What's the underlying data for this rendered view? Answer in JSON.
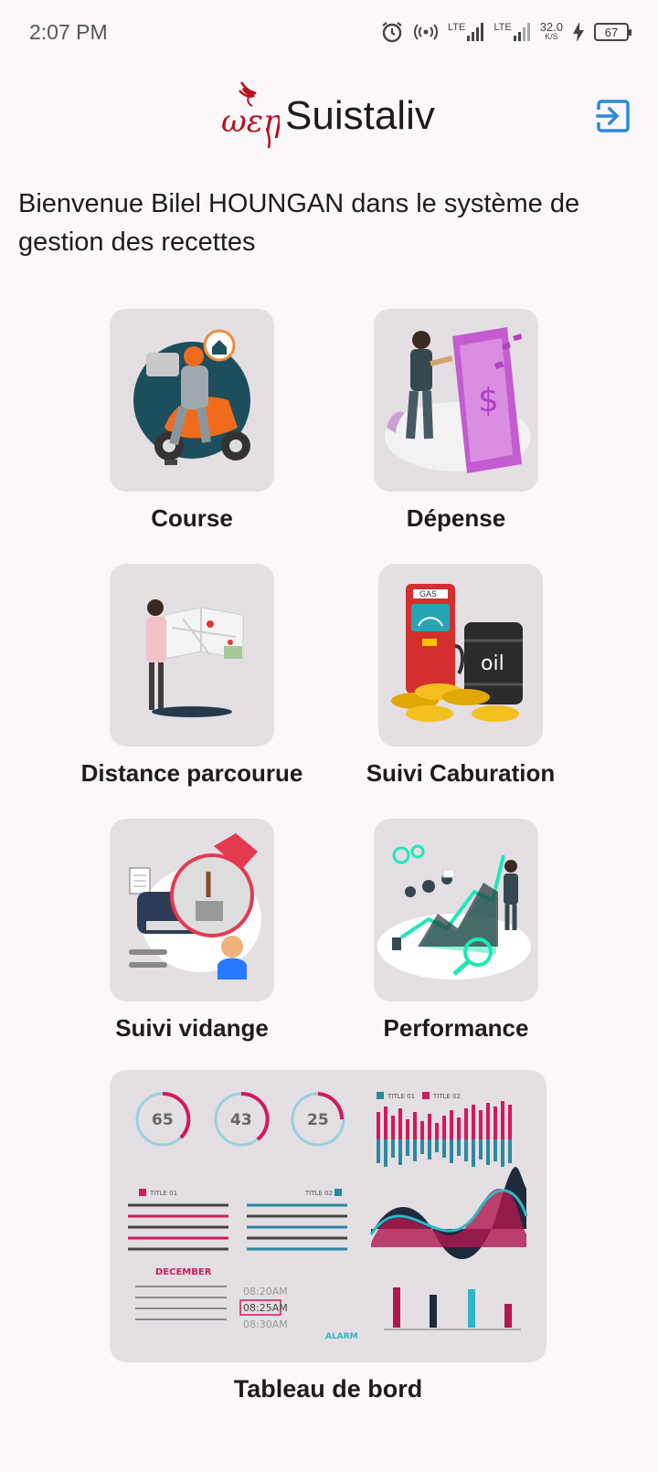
{
  "status_bar": {
    "time": "2:07 PM",
    "network_1": "LTE",
    "network_2": "LTE",
    "speed_value": "32.0",
    "speed_unit": "K/S",
    "battery": "67"
  },
  "header": {
    "logo_text": "ωεη",
    "title": "Suistaliv",
    "logout_icon": "logout-icon"
  },
  "welcome_text": "Bienvenue Bilel HOUNGAN dans le système de gestion des recettes",
  "menu": {
    "course": "Course",
    "depense": "Dépense",
    "distance": "Distance parcourue",
    "caburation": "Suivi Caburation",
    "vidange": "Suivi vidange",
    "performance": "Performance",
    "tableau": "Tableau de bord"
  },
  "illustrations": {
    "dash_gauges": [
      "65",
      "43",
      "25"
    ],
    "dash_title_1": "TITLE 01",
    "dash_title_2": "TITLE 02",
    "dash_month": "DECEMBER",
    "dash_alarm": "ALARM",
    "dash_times": [
      "08:20AM",
      "08:25AM",
      "08:30AM"
    ],
    "oil_text": "oil",
    "gas_text": "GAS"
  },
  "colors": {
    "background": "#fcf7fb",
    "card": "#e3dfe3",
    "accent_blue": "#2a8ad8",
    "logo_red": "#b5121b"
  }
}
